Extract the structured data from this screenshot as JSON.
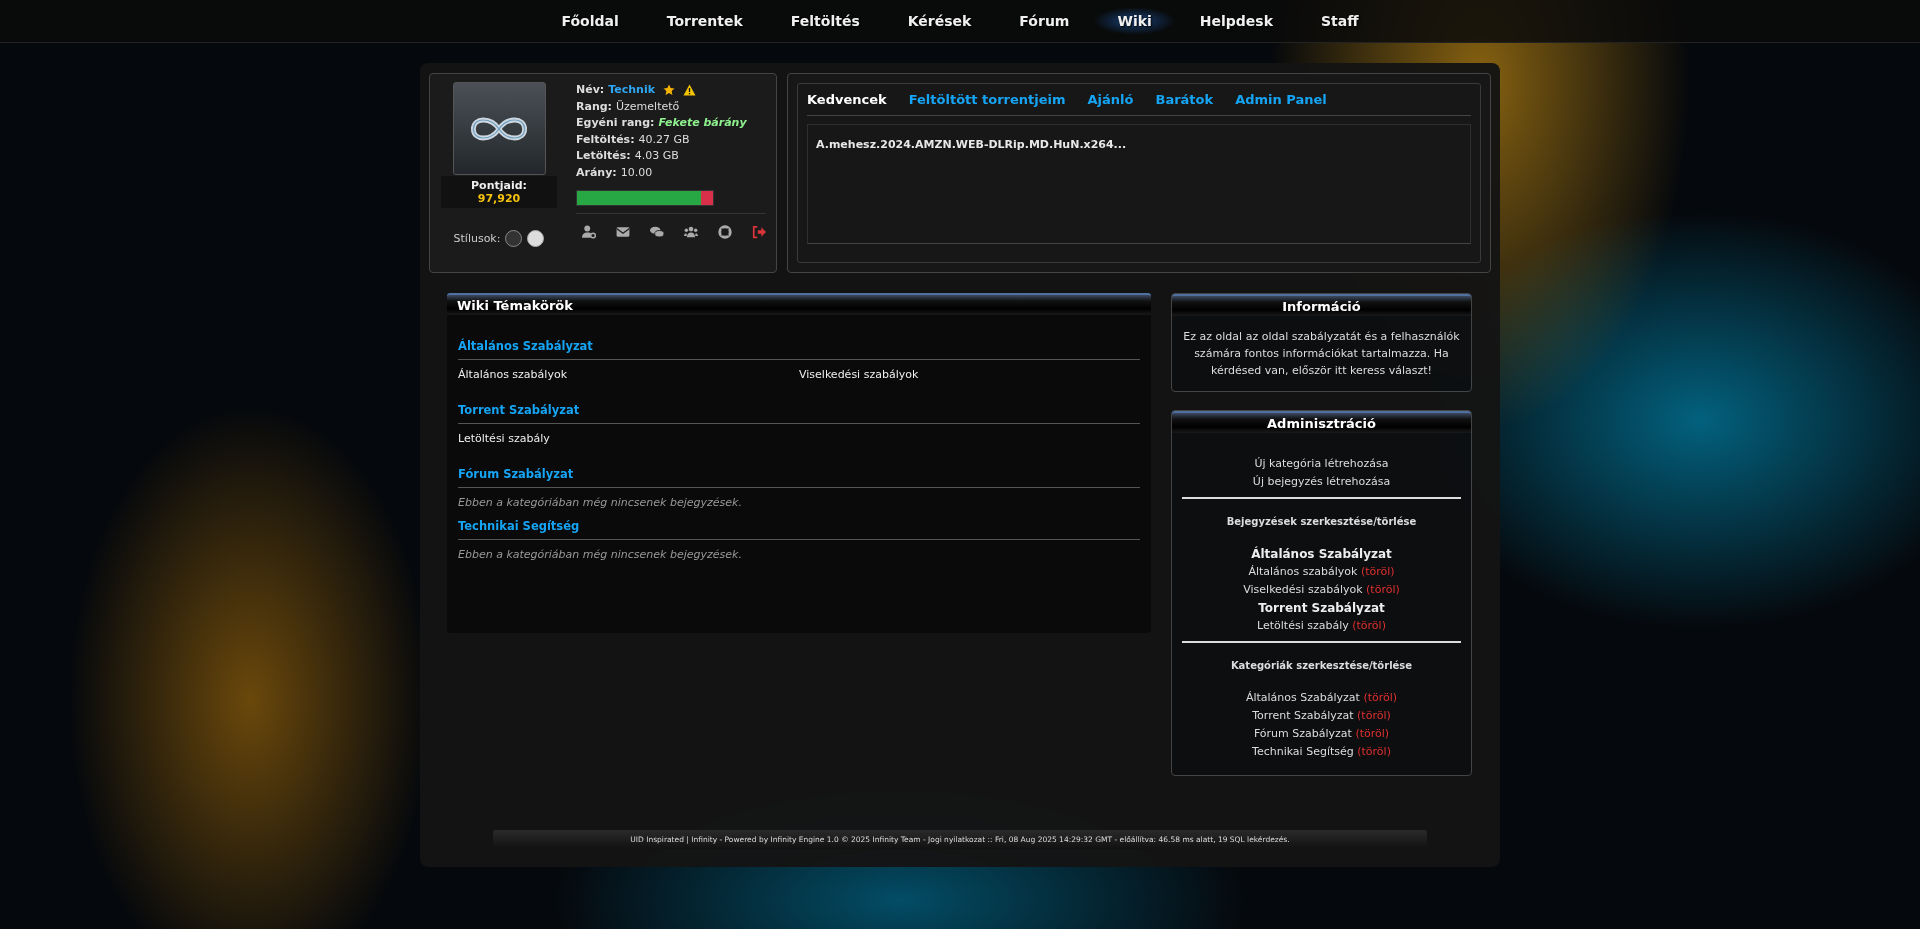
{
  "nav": [
    {
      "label": "Főoldal",
      "selected": false
    },
    {
      "label": "Torrentek",
      "selected": false
    },
    {
      "label": "Feltöltés",
      "selected": false
    },
    {
      "label": "Kérések",
      "selected": false
    },
    {
      "label": "Fórum",
      "selected": false
    },
    {
      "label": "Wiki",
      "selected": true
    },
    {
      "label": "Helpdesk",
      "selected": false
    },
    {
      "label": "Staff"
    }
  ],
  "profile": {
    "points_label": "Pontjaid:",
    "points": "97,920",
    "styles_label": "Stílusok:",
    "fields": [
      {
        "label": "Név:",
        "value": "Technik",
        "kind": "name"
      },
      {
        "label": "Rang:",
        "value": "Üzemeltető",
        "kind": "plain"
      },
      {
        "label": "Egyéni rang:",
        "value": "Fekete bárány",
        "kind": "custom"
      },
      {
        "label": "Feltöltés:",
        "value": "40.27 GB",
        "kind": "plain"
      },
      {
        "label": "Letöltés:",
        "value": "4.03 GB",
        "kind": "plain"
      },
      {
        "label": "Arány:",
        "value": "10.00",
        "kind": "plain"
      }
    ],
    "ratio_bar": {
      "level": 0.91
    }
  },
  "tabs": [
    {
      "label": "Kedvencek",
      "selected": true
    },
    {
      "label": "Feltöltött torrentjeim",
      "selected": false
    },
    {
      "label": "Ajánló",
      "selected": false
    },
    {
      "label": "Barátok",
      "selected": false
    },
    {
      "label": "Admin Panel",
      "selected": false
    }
  ],
  "favorites": [
    "A.mehesz.2024.AMZN.WEB-DLRip.MD.HuN.x264..."
  ],
  "wiki": {
    "title": "Wiki Témakörök",
    "categories": [
      {
        "name": "Általános Szabályzat",
        "entries": [
          "Általános szabályok",
          "Viselkedési szabályok"
        ]
      },
      {
        "name": "Torrent Szabályzat",
        "entries": [
          "Letöltési szabály"
        ]
      },
      {
        "name": "Fórum Szabályzat",
        "empty_text": "Ebben a kategóriában még nincsenek bejegyzések."
      },
      {
        "name": "Technikai Segítség",
        "empty_text": "Ebben a kategóriában még nincsenek bejegyzések."
      }
    ]
  },
  "info": {
    "title": "Információ",
    "text": "Ez az oldal az oldal szabályzatát és a felhasználók számára fontos információkat tartalmazza. Ha kérdésed van, először itt keress választ!"
  },
  "admin": {
    "title": "Adminisztráció",
    "create_links": [
      "Új kategória létrehozása",
      "Új bejegyzés létrehozása"
    ],
    "entries_edit": {
      "title": "Bejegyzések szerkesztése/törlése",
      "groups": [
        {
          "name": "Általános Szabályzat",
          "entries": [
            {
              "label": "Általános szabályok",
              "action": "(töröl)"
            },
            {
              "label": "Viselkedési szabályok",
              "action": "(töröl)"
            }
          ]
        },
        {
          "name": "Torrent Szabályzat",
          "entries": [
            {
              "label": "Letöltési szabály",
              "action": "(töröl)"
            }
          ]
        }
      ]
    },
    "categories_edit": {
      "title": "Kategóriák szerkesztése/törlése",
      "items": [
        {
          "label": "Általános Szabályzat",
          "action": "(töröl)"
        },
        {
          "label": "Torrent Szabályzat",
          "action": "(töröl)"
        },
        {
          "label": "Fórum Szabályzat",
          "action": "(töröl)"
        },
        {
          "label": "Technikai Segítség",
          "action": "(töröl)"
        }
      ]
    }
  },
  "footer": "UID Inspirated | Infinity - Powered by Infinity Engine 1.0 © 2025 Infinity Team - Jogi nyilatkozat :: Fri, 08 Aug 2025 14:29:32 GMT - előállítva: 46.58 ms alatt, 19 SQL lekérdezés."
}
